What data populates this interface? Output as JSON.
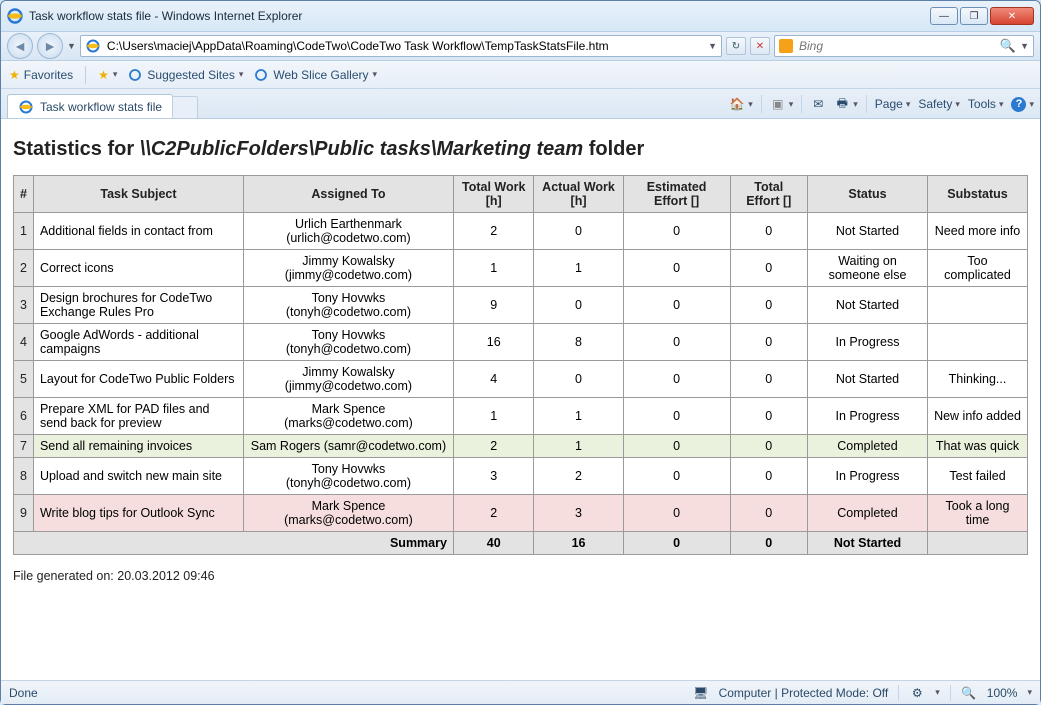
{
  "window": {
    "title": "Task workflow stats file - Windows Internet Explorer"
  },
  "nav": {
    "url": "C:\\Users\\maciej\\AppData\\Roaming\\CodeTwo\\CodeTwo Task Workflow\\TempTaskStatsFile.htm",
    "search_placeholder": "Bing"
  },
  "favbar": {
    "favorites": "Favorites",
    "suggested": "Suggested Sites",
    "webslice": "Web Slice Gallery"
  },
  "tab": {
    "title": "Task workflow stats file"
  },
  "cmdbar": {
    "page": "Page",
    "safety": "Safety",
    "tools": "Tools"
  },
  "page": {
    "heading_prefix": "Statistics for ",
    "heading_path": "\\\\C2PublicFolders\\Public tasks\\Marketing team",
    "heading_suffix": " folder",
    "columns": [
      "#",
      "Task Subject",
      "Assigned To",
      "Total Work [h]",
      "Actual Work [h]",
      "Estimated Effort []",
      "Total Effort []",
      "Status",
      "Substatus"
    ],
    "rows": [
      {
        "n": "1",
        "subject": "Additional fields in contact from",
        "assigned_name": "Urlich Earthenmark",
        "assigned_email": "(urlich@codetwo.com)",
        "tw": "2",
        "aw": "0",
        "ee": "0",
        "te": "0",
        "status": "Not Started",
        "sub": "Need more info",
        "cls": ""
      },
      {
        "n": "2",
        "subject": "Correct icons",
        "assigned_name": "Jimmy Kowalsky",
        "assigned_email": "(jimmy@codetwo.com)",
        "tw": "1",
        "aw": "1",
        "ee": "0",
        "te": "0",
        "status": "Waiting on someone else",
        "sub": "Too complicated",
        "cls": ""
      },
      {
        "n": "3",
        "subject": "Design brochures for CodeTwo Exchange Rules Pro",
        "assigned_name": "Tony Hovwks",
        "assigned_email": "(tonyh@codetwo.com)",
        "tw": "9",
        "aw": "0",
        "ee": "0",
        "te": "0",
        "status": "Not Started",
        "sub": "",
        "cls": ""
      },
      {
        "n": "4",
        "subject": "Google AdWords - additional campaigns",
        "assigned_name": "Tony Hovwks",
        "assigned_email": "(tonyh@codetwo.com)",
        "tw": "16",
        "aw": "8",
        "ee": "0",
        "te": "0",
        "status": "In Progress",
        "sub": "",
        "cls": ""
      },
      {
        "n": "5",
        "subject": "Layout for CodeTwo Public Folders",
        "assigned_name": "Jimmy Kowalsky",
        "assigned_email": "(jimmy@codetwo.com)",
        "tw": "4",
        "aw": "0",
        "ee": "0",
        "te": "0",
        "status": "Not Started",
        "sub": "Thinking...",
        "cls": ""
      },
      {
        "n": "6",
        "subject": "Prepare XML for PAD files and send back for preview",
        "assigned_name": "Mark Spence",
        "assigned_email": "(marks@codetwo.com)",
        "tw": "1",
        "aw": "1",
        "ee": "0",
        "te": "0",
        "status": "In Progress",
        "sub": "New info added",
        "cls": ""
      },
      {
        "n": "7",
        "subject": "Send all remaining invoices",
        "assigned_name": "Sam Rogers (samr@codetwo.com)",
        "assigned_email": "",
        "tw": "2",
        "aw": "1",
        "ee": "0",
        "te": "0",
        "status": "Completed",
        "sub": "That was quick",
        "cls": "row-green"
      },
      {
        "n": "8",
        "subject": "Upload and switch new main site",
        "assigned_name": "Tony Hovwks",
        "assigned_email": "(tonyh@codetwo.com)",
        "tw": "3",
        "aw": "2",
        "ee": "0",
        "te": "0",
        "status": "In Progress",
        "sub": "Test failed",
        "cls": ""
      },
      {
        "n": "9",
        "subject": "Write blog tips for Outlook Sync",
        "assigned_name": "Mark Spence",
        "assigned_email": "(marks@codetwo.com)",
        "tw": "2",
        "aw": "3",
        "ee": "0",
        "te": "0",
        "status": "Completed",
        "sub": "Took a long time",
        "cls": "row-pink"
      }
    ],
    "summary": {
      "label": "Summary",
      "tw": "40",
      "aw": "16",
      "ee": "0",
      "te": "0",
      "status": "Not Started",
      "sub": ""
    },
    "generated": "File generated on: 20.03.2012 09:46"
  },
  "status": {
    "done": "Done",
    "zone": "Computer | Protected Mode: Off",
    "zoom": "100%"
  }
}
